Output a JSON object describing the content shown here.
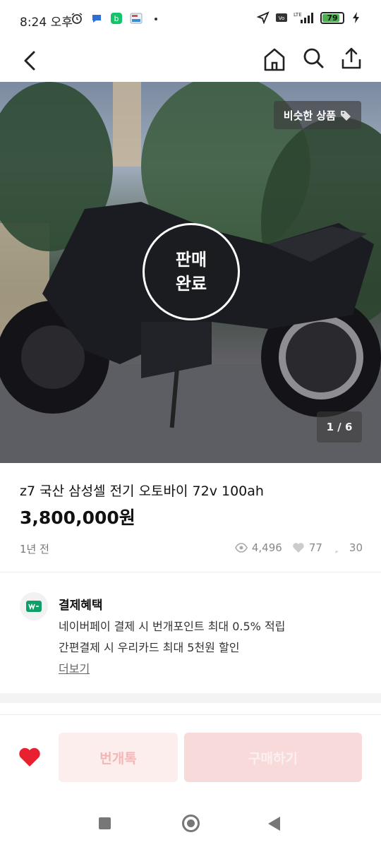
{
  "status_bar": {
    "time": "8:24 오후",
    "battery": "79",
    "network": "LTE"
  },
  "top_nav": {
    "icons": [
      "back-icon",
      "home-icon",
      "search-icon",
      "share-icon"
    ]
  },
  "hero": {
    "similar_label": "비슷한 상품",
    "sold_line1": "판매",
    "sold_line2": "완료",
    "photo_counter": "1 / 6"
  },
  "product": {
    "title": "z7 국산 삼성셀 전기 오토바이 72v 100ah",
    "price": "3,800,000원",
    "posted": "1년 전",
    "views": "4,496",
    "likes": "77",
    "chats": "30"
  },
  "benefit": {
    "title": "결제혜택",
    "line1": "네이버페이 결제 시 번개포인트 최대 0.5% 적립",
    "line2": "간편결제 시 우리카드 최대 5천원 할인",
    "more": "더보기"
  },
  "actions": {
    "chat_label": "번개톡",
    "buy_label": "구매하기",
    "like_color": "#e8202f"
  }
}
